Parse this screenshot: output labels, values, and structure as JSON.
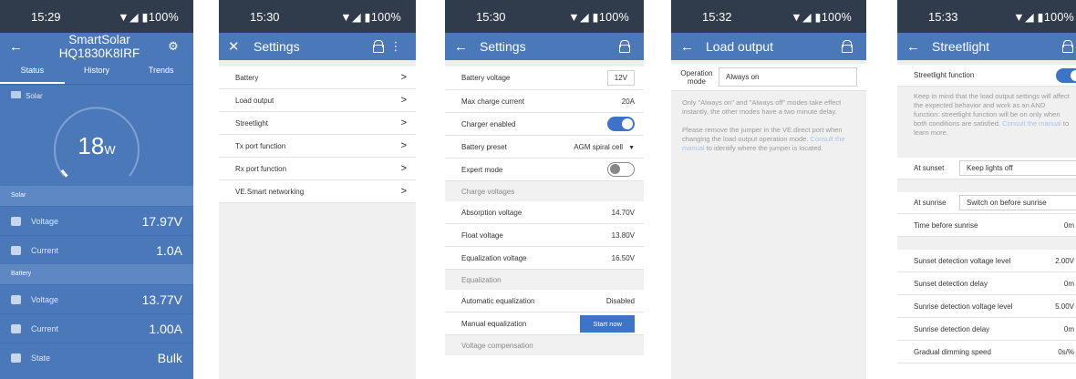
{
  "phones": {
    "status": {
      "time": "15:29",
      "signal": "▼◢ ▮100%",
      "title": "SmartSolar HQ1830K8IRF",
      "tabs": [
        "Status",
        "History",
        "Trends"
      ],
      "solar_label": "Solar",
      "solar_watts": "18",
      "solar_unit": "W",
      "solar_fraction": 0.04,
      "section_solar": "Solar",
      "section_battery": "Battery",
      "solar_voltage_label": "Voltage",
      "solar_voltage": "17.97V",
      "solar_current_label": "Current",
      "solar_current": "1.0A",
      "battery_voltage_label": "Voltage",
      "battery_voltage": "13.77V",
      "battery_current_label": "Current",
      "battery_current": "1.00A",
      "state_label": "State",
      "state_value": "Bulk"
    },
    "settings": {
      "time": "15:30",
      "signal": "▼◢ ▮100%",
      "title": "Settings",
      "items": [
        "Battery",
        "Load output",
        "Streetlight",
        "Tx port function",
        "Rx port function",
        "VE.Smart networking"
      ]
    },
    "battery": {
      "time": "15:30",
      "signal": "▼◢ ▮100%",
      "title": "Settings",
      "battery_voltage_label": "Battery voltage",
      "battery_voltage": "12V",
      "max_charge_label": "Max charge current",
      "max_charge": "20A",
      "charger_enabled_label": "Charger enabled",
      "battery_preset_label": "Battery preset",
      "battery_preset": "AGM spiral cell",
      "expert_mode_label": "Expert mode",
      "charge_voltages_section": "Charge voltages",
      "absorption_label": "Absorption voltage",
      "absorption": "14.70V",
      "float_label": "Float voltage",
      "float": "13.80V",
      "equalization_label": "Equalization voltage",
      "equalization": "16.50V",
      "equalization_section": "Equalization",
      "auto_eq_label": "Automatic equalization",
      "auto_eq": "Disabled",
      "manual_eq_label": "Manual equalization",
      "start_now": "Start now",
      "voltage_comp_section": "Voltage compensation"
    },
    "load": {
      "time": "15:32",
      "signal": "▼◢ ▮100%",
      "title": "Load output",
      "operation_label": "Operation mode",
      "operation_value": "Always on",
      "note1": "Only \"Always on\" and \"Always off\" modes take effect instantly, the other modes have a two minute delay.",
      "note2_a": "Please remove the jumper in the VE.direct port when changing the load output operation mode.",
      "note2_link": "Consult the manual",
      "note2_b": " to identify where the jumper is located."
    },
    "streetlight": {
      "time": "15:33",
      "signal": "▼◢ ▮100%",
      "title": "Streetlight",
      "function_label": "Streetlight function",
      "note_a": "Keep in mind that the load output settings will affect the expected behavior and work as an AND function: streetlight function will be on only when both conditions are satisfied.",
      "note_link": "Consult the manual",
      "note_b": " to learn more.",
      "at_sunset_label": "At sunset",
      "at_sunset": "Keep lights off",
      "at_sunrise_label": "At sunrise",
      "at_sunrise": "Switch on before sunrise",
      "time_before_label": "Time before sunrise",
      "time_before": "0m",
      "sunset_level_label": "Sunset detection voltage level",
      "sunset_level": "2.00V",
      "sunset_delay_label": "Sunset detection delay",
      "sunset_delay": "0m",
      "sunrise_level_label": "Sunrise detection voltage level",
      "sunrise_level": "5.00V",
      "sunrise_delay_label": "Sunrise detection delay",
      "sunrise_delay": "0m",
      "dimming_label": "Gradual dimming speed",
      "dimming": "0s/%"
    }
  },
  "colors": {
    "header": "#4a78b8",
    "statusbar": "#303c4c",
    "accent": "#3d74c8"
  }
}
